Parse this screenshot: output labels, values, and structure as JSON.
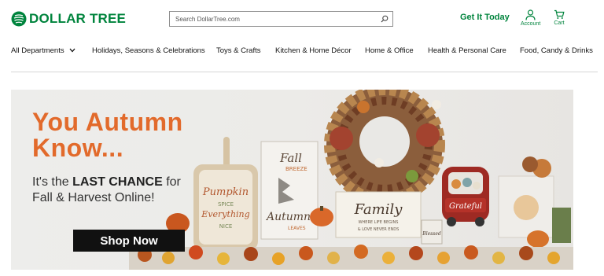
{
  "brand": {
    "logo_text": "DOLLAR TREE",
    "color": "#00843d"
  },
  "search": {
    "placeholder": "Search DollarTree.com",
    "icon": "search-icon"
  },
  "header": {
    "get_it_today": "Get It Today",
    "account_label": "Account",
    "cart_label": "Cart"
  },
  "nav": {
    "items": [
      "All Departments",
      "Holidays, Seasons & Celebrations",
      "Toys & Crafts",
      "Kitchen & Home Décor",
      "Home & Office",
      "Health & Personal Care",
      "Food, Candy & Drinks"
    ]
  },
  "hero": {
    "headline_line1": "You Autumn",
    "headline_line2": "Know...",
    "sub_prefix": "It's the ",
    "sub_bold": "LAST CHANCE",
    "sub_suffix": " for",
    "sub_line2": "Fall & Harvest Online!",
    "cta_label": "Shop Now",
    "accent_color": "#e26a2b",
    "sign_fall": "Fall",
    "sign_breeze": "BREEZE",
    "sign_autumn": "Autumn",
    "sign_leaves": "LEAVES",
    "board_pumpkin": "Pumpkin",
    "board_spice": "SPICE",
    "board_everything": "Everything",
    "board_nice": "NICE",
    "family_title": "Family",
    "family_line1": "WHERE LIFE BEGINS",
    "family_line2": "& LOVE NEVER ENDS",
    "blessed": "Blessed",
    "grateful": "Grateful"
  }
}
